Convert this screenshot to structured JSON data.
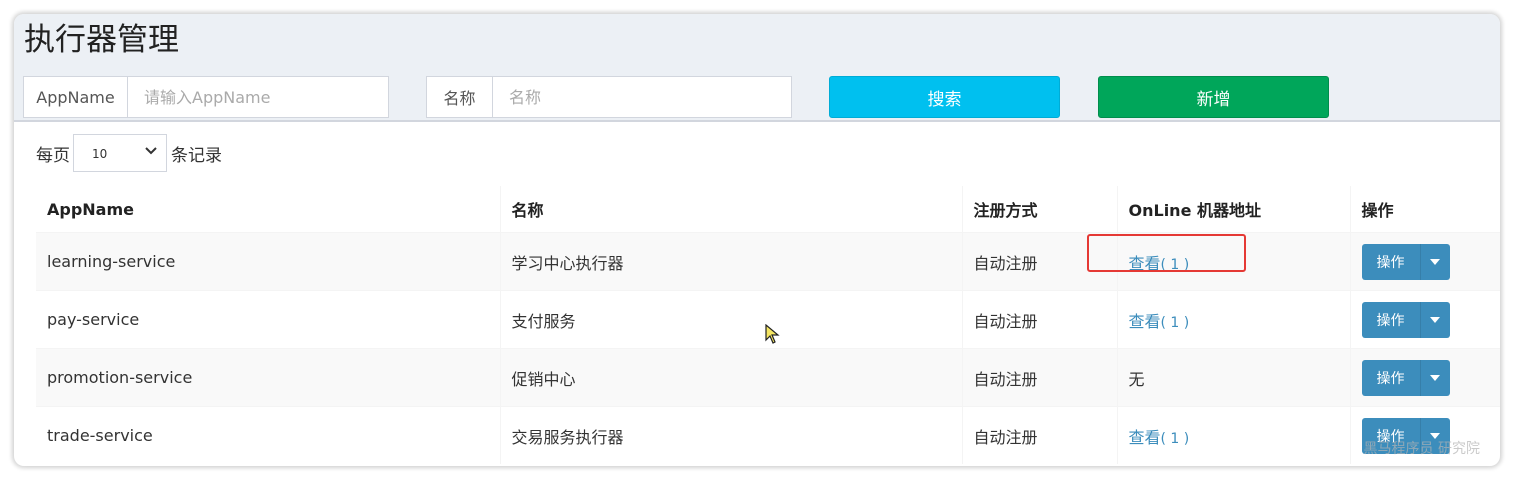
{
  "page": {
    "title": "执行器管理"
  },
  "filters": {
    "appname": {
      "label": "AppName",
      "placeholder": "请输入AppName"
    },
    "name": {
      "label": "名称",
      "placeholder": "名称"
    },
    "search_label": "搜索",
    "add_label": "新增"
  },
  "length": {
    "prefix": "每页",
    "value": "10",
    "suffix": "条记录"
  },
  "table": {
    "headers": [
      "AppName",
      "名称",
      "注册方式",
      "OnLine 机器地址",
      "操作"
    ],
    "rows": [
      {
        "appname": "learning-service",
        "name": "学习中心执行器",
        "reg": "自动注册",
        "online": "查看",
        "online_count": "( 1 )",
        "op": "操作"
      },
      {
        "appname": "pay-service",
        "name": "支付服务",
        "reg": "自动注册",
        "online": "查看",
        "online_count": "( 1 )",
        "op": "操作"
      },
      {
        "appname": "promotion-service",
        "name": "促销中心",
        "reg": "自动注册",
        "online": "无",
        "online_count": "",
        "op": "操作"
      },
      {
        "appname": "trade-service",
        "name": "交易服务执行器",
        "reg": "自动注册",
        "online": "查看",
        "online_count": "( 1 )",
        "op": "操作"
      }
    ]
  },
  "watermark": "黑马程序员 研究院",
  "colors": {
    "info": "#00c0ef",
    "success": "#00a65a",
    "primary": "#3c8dbc",
    "highlight": "#e53935"
  }
}
